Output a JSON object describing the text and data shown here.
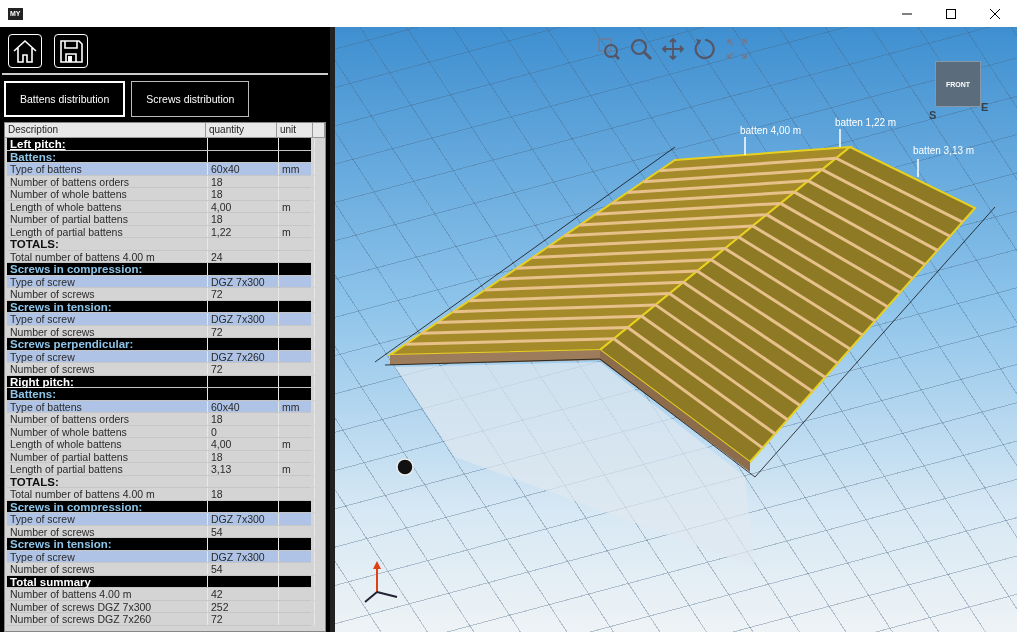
{
  "window": {
    "app_icon": "MY"
  },
  "toolbar": {
    "buttons": [
      {
        "kind": "home"
      },
      {
        "kind": "save"
      }
    ]
  },
  "tabs": [
    {
      "label": "Battens distribution",
      "selected": true
    },
    {
      "label": "Screws distribution",
      "selected": false
    }
  ],
  "table": {
    "columns": [
      "Description",
      "quantity",
      "unit"
    ],
    "rows": [
      {
        "kind": "section",
        "cells": [
          "Left pitch:",
          "",
          ""
        ]
      },
      {
        "kind": "group",
        "cells": [
          "Battens:",
          "",
          ""
        ]
      },
      {
        "kind": "highlight",
        "cells": [
          "Type of battens",
          "60x40",
          "mm"
        ]
      },
      {
        "kind": "normal",
        "cells": [
          "Number of battens orders",
          "18",
          ""
        ]
      },
      {
        "kind": "normal",
        "cells": [
          "Number of whole battens",
          "18",
          ""
        ]
      },
      {
        "kind": "normal",
        "cells": [
          "Length of whole battens",
          "4,00",
          "m"
        ]
      },
      {
        "kind": "normal",
        "cells": [
          "Number of partial battens",
          "18",
          ""
        ]
      },
      {
        "kind": "normal",
        "cells": [
          "Length of partial battens",
          "1,22",
          "m"
        ]
      },
      {
        "kind": "totals",
        "cells": [
          "TOTALS:",
          "",
          ""
        ]
      },
      {
        "kind": "normal",
        "cells": [
          "Total number of battens 4.00 m",
          "24",
          ""
        ]
      },
      {
        "kind": "group",
        "cells": [
          "Screws in compression:",
          "",
          ""
        ]
      },
      {
        "kind": "highlight",
        "cells": [
          "Type of screw",
          "DGZ 7x300",
          ""
        ]
      },
      {
        "kind": "normal",
        "cells": [
          "Number of screws",
          "72",
          ""
        ]
      },
      {
        "kind": "group",
        "cells": [
          "Screws in tension:",
          "",
          ""
        ]
      },
      {
        "kind": "highlight",
        "cells": [
          "Type of screw",
          "DGZ 7x300",
          ""
        ]
      },
      {
        "kind": "normal",
        "cells": [
          "Number of screws",
          "72",
          ""
        ]
      },
      {
        "kind": "group",
        "cells": [
          "Screws perpendicular:",
          "",
          ""
        ]
      },
      {
        "kind": "highlight",
        "cells": [
          "Type of screw",
          "DGZ 7x260",
          ""
        ]
      },
      {
        "kind": "normal",
        "cells": [
          "Number of screws",
          "72",
          ""
        ]
      },
      {
        "kind": "section",
        "cells": [
          "Right pitch:",
          "",
          ""
        ]
      },
      {
        "kind": "group",
        "cells": [
          "Battens:",
          "",
          ""
        ]
      },
      {
        "kind": "highlight",
        "cells": [
          "Type of battens",
          "60x40",
          "mm"
        ]
      },
      {
        "kind": "normal",
        "cells": [
          "Number of battens orders",
          "18",
          ""
        ]
      },
      {
        "kind": "normal",
        "cells": [
          "Number of whole battens",
          "0",
          ""
        ]
      },
      {
        "kind": "normal",
        "cells": [
          "Length of whole battens",
          "4,00",
          "m"
        ]
      },
      {
        "kind": "normal",
        "cells": [
          "Number of partial battens",
          "18",
          ""
        ]
      },
      {
        "kind": "normal",
        "cells": [
          "Length of partial battens",
          "3,13",
          "m"
        ]
      },
      {
        "kind": "totals",
        "cells": [
          "TOTALS:",
          "",
          ""
        ]
      },
      {
        "kind": "normal",
        "cells": [
          "Total number of battens 4.00 m",
          "18",
          ""
        ]
      },
      {
        "kind": "group",
        "cells": [
          "Screws in compression:",
          "",
          ""
        ]
      },
      {
        "kind": "highlight",
        "cells": [
          "Type of screw",
          "DGZ 7x300",
          ""
        ]
      },
      {
        "kind": "normal",
        "cells": [
          "Number of screws",
          "54",
          ""
        ]
      },
      {
        "kind": "group",
        "cells": [
          "Screws in tension:",
          "",
          ""
        ]
      },
      {
        "kind": "highlight",
        "cells": [
          "Type of screw",
          "DGZ 7x300",
          ""
        ]
      },
      {
        "kind": "normal",
        "cells": [
          "Number of screws",
          "54",
          ""
        ]
      },
      {
        "kind": "summary",
        "cells": [
          "Total summary",
          "",
          ""
        ]
      },
      {
        "kind": "normal",
        "cells": [
          "Number of battens 4.00 m",
          "42",
          ""
        ]
      },
      {
        "kind": "normal",
        "cells": [
          "Number of screws DGZ 7x300",
          "252",
          ""
        ]
      },
      {
        "kind": "normal",
        "cells": [
          "Number of screws DGZ 7x260",
          "72",
          ""
        ]
      }
    ]
  },
  "viewport": {
    "tools": [
      {
        "kind": "zoom-window"
      },
      {
        "kind": "zoom"
      },
      {
        "kind": "pan"
      },
      {
        "kind": "rotate"
      },
      {
        "kind": "fit"
      }
    ],
    "view_cube": {
      "face": "FRONT",
      "compass": [
        "S",
        "E"
      ]
    },
    "labels": [
      "batten 4,00 m",
      "batten 1,22 m",
      "batten 3,13 m"
    ]
  }
}
